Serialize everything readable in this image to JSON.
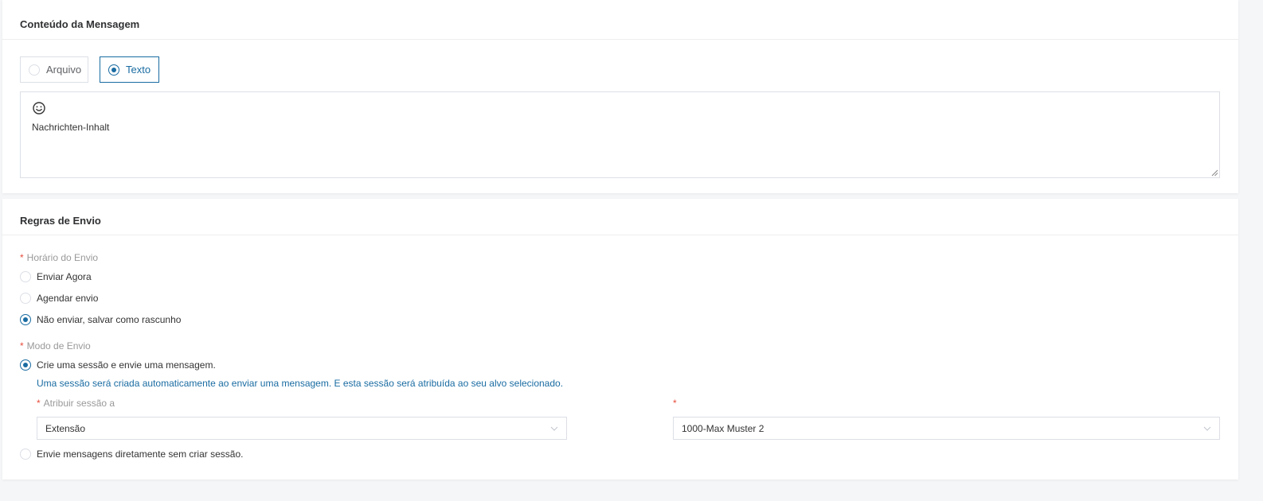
{
  "message_content": {
    "title": "Conteúdo da Mensagem",
    "type_options": [
      {
        "label": "Arquivo",
        "selected": false
      },
      {
        "label": "Texto",
        "selected": true
      }
    ],
    "emoji_icon": "smiley-icon",
    "body_text": "Nachrichten-Inhalt"
  },
  "sending_rules": {
    "title": "Regras de Envio",
    "required_mark": "*",
    "send_time": {
      "label": "Horário do Envio",
      "options": [
        {
          "label": "Enviar Agora",
          "selected": false
        },
        {
          "label": "Agendar envio",
          "selected": false
        },
        {
          "label": "Não enviar, salvar como rascunho",
          "selected": true
        }
      ]
    },
    "send_mode": {
      "label": "Modo de Envio",
      "option_session": {
        "label": "Crie uma sessão e envie uma mensagem.",
        "selected": true
      },
      "session_hint": "Uma sessão será criada automaticamente ao enviar uma mensagem. E esta sessão será atribuída ao seu alvo selecionado.",
      "assign_label": "Atribuir sessão a",
      "assign_value": "Extensão",
      "target_value": "1000-Max Muster 2",
      "option_direct": {
        "label": "Envie mensagens diretamente sem criar sessão.",
        "selected": false
      }
    }
  },
  "colors": {
    "accent": "#1a6ca2",
    "required": "#e74c3c",
    "border": "#dcdfe6"
  }
}
